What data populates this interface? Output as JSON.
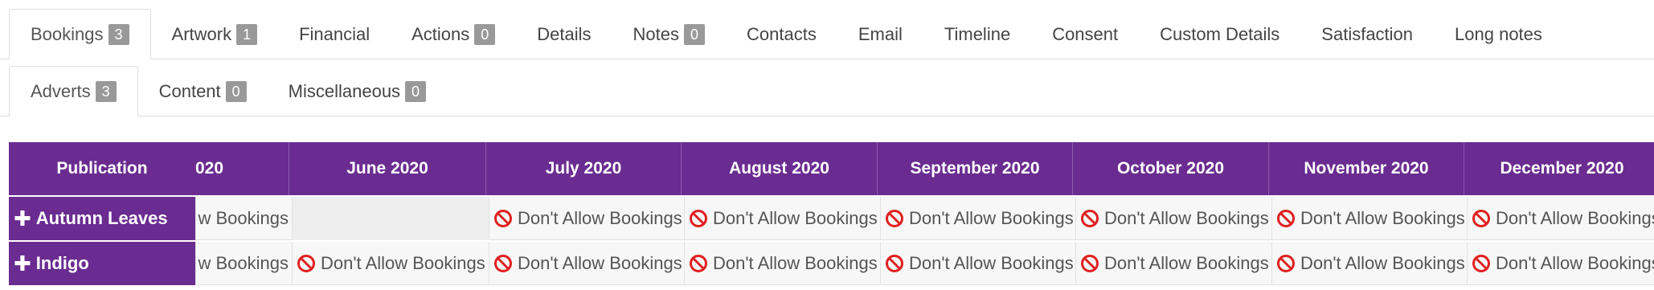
{
  "tabs_primary": [
    {
      "label": "Bookings",
      "count": "3"
    },
    {
      "label": "Artwork",
      "count": "1"
    },
    {
      "label": "Financial",
      "count": ""
    },
    {
      "label": "Actions",
      "count": "0"
    },
    {
      "label": "Details",
      "count": ""
    },
    {
      "label": "Notes",
      "count": "0"
    },
    {
      "label": "Contacts",
      "count": ""
    },
    {
      "label": "Email",
      "count": ""
    },
    {
      "label": "Timeline",
      "count": ""
    },
    {
      "label": "Consent",
      "count": ""
    },
    {
      "label": "Custom Details",
      "count": ""
    },
    {
      "label": "Satisfaction",
      "count": ""
    },
    {
      "label": "Long notes",
      "count": ""
    }
  ],
  "tabs_secondary": [
    {
      "label": "Adverts",
      "count": "3"
    },
    {
      "label": "Content",
      "count": "0"
    },
    {
      "label": "Miscellaneous",
      "count": "0"
    }
  ],
  "grid": {
    "publication_header": "Publication",
    "months": [
      "020",
      "June 2020",
      "July 2020",
      "August 2020",
      "September 2020",
      "October 2020",
      "November 2020",
      "December 2020"
    ],
    "rows": [
      {
        "publication": "Autumn Leaves",
        "cells": [
          "w Bookings",
          "",
          "Don't Allow Bookings",
          "Don't Allow Bookings",
          "Don't Allow Bookings",
          "Don't Allow Bookings",
          "Don't Allow Bookings",
          "Don't Allow Bookings"
        ]
      },
      {
        "publication": "Indigo",
        "cells": [
          "w Bookings",
          "Don't Allow Bookings",
          "Don't Allow Bookings",
          "Don't Allow Bookings",
          "Don't Allow Bookings",
          "Don't Allow Bookings",
          "Don't Allow Bookings",
          "Don't Allow Bookings"
        ]
      }
    ]
  },
  "colors": {
    "header_purple": "#6a2c91",
    "no_icon_red": "#e02020"
  },
  "icons": {
    "expand": "plus-icon",
    "blocked": "no-entry-icon"
  }
}
